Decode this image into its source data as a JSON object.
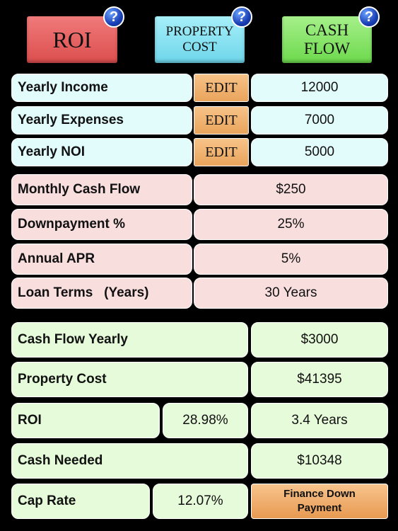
{
  "header": {
    "roi_label": "ROI",
    "property_cost_label": "PROPERTY COST",
    "cash_flow_label": "CASH FLOW",
    "help_glyph": "?"
  },
  "income_rows": [
    {
      "label": "Yearly Income",
      "edit": "EDIT",
      "value": "12000"
    },
    {
      "label": "Yearly Expenses",
      "edit": "EDIT",
      "value": "7000"
    },
    {
      "label": "Yearly NOI",
      "edit": "EDIT",
      "value": "5000"
    }
  ],
  "loan_rows": [
    {
      "label": "Monthly Cash Flow",
      "value": "$250"
    },
    {
      "label": "Downpayment %",
      "value": "25%"
    },
    {
      "label": "Annual APR",
      "value": "5%"
    },
    {
      "label": "Loan Terms   (Years)",
      "value": "30 Years"
    }
  ],
  "results": {
    "cash_flow_yearly": {
      "label": "Cash Flow Yearly",
      "value": "$3000"
    },
    "property_cost": {
      "label": "Property Cost",
      "value": "$41395"
    },
    "roi": {
      "label": "ROI",
      "percent": "28.98%",
      "value": "3.4 Years"
    },
    "cash_needed": {
      "label": "Cash Needed",
      "value": "$10348"
    },
    "cap_rate": {
      "label": "Cap Rate",
      "percent": "12.07%"
    },
    "finance_button": "Finance Down Payment"
  },
  "colors": {
    "roi_tab": "#e85c5c",
    "property_tab": "#8fe6f5",
    "cash_flow_tab": "#8ce66a"
  }
}
